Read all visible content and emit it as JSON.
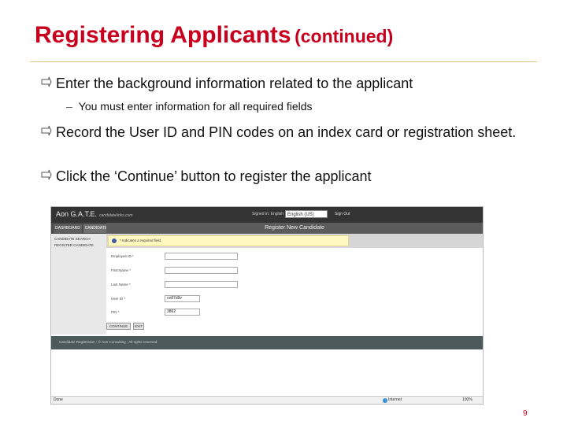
{
  "slide": {
    "title_main": "Registering Applicants",
    "title_paren": "(continued)",
    "bullets": [
      "Enter the background information related to the applicant",
      "Record the User ID and PIN codes on an index card or registration sheet.",
      "Click the ‘Continue’ button to register the applicant"
    ],
    "sub_bullet": "You must enter information for all required fields",
    "sub_dash": "–",
    "page_number": "9",
    "title_color": "#c8001e"
  },
  "screenshot": {
    "brand": "Aon G.A.T.E.",
    "brand_tag": "candidatelinks.com",
    "signed_in_label": "Signed in: English",
    "language_select": "English (US)",
    "sign_out": "Sign Out",
    "tabs": [
      "DASHBOARD",
      "CANDIDATE"
    ],
    "sidebar": [
      "CANDIDATE SEARCH",
      "REGISTER CANDIDATE"
    ],
    "panel_title": "Register New Candidate",
    "notice": "* Indicates a required field.",
    "fields": [
      {
        "label": "Employee ID *",
        "value": ""
      },
      {
        "label": "First Name *",
        "value": ""
      },
      {
        "label": "Last Name *",
        "value": ""
      },
      {
        "label": "User ID *",
        "value": "ce87d9v"
      },
      {
        "label": "PIN *",
        "value": "3862"
      }
    ],
    "buttons": [
      "CONTINUE",
      "EXIT"
    ],
    "footer": "Candidate Registration - © Aon Consulting - All rights reserved",
    "status_done": "Done",
    "status_zone": "Internet",
    "status_zoom": "100%"
  }
}
